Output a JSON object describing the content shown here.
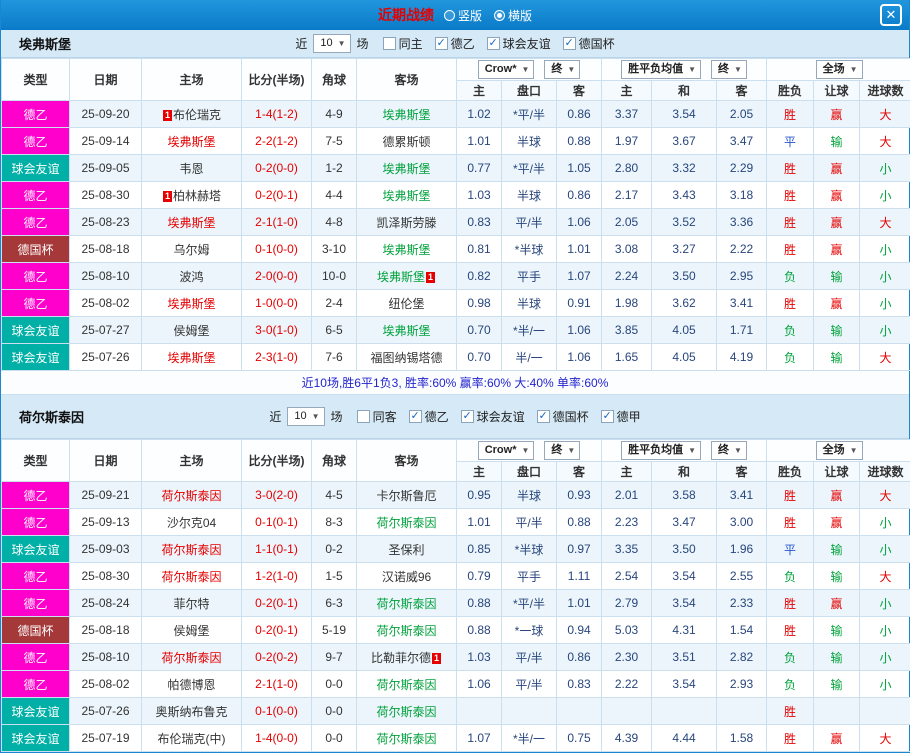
{
  "window": {
    "title": "近期战绩",
    "view_options": [
      {
        "label": "竖版",
        "sel_class": ""
      },
      {
        "label": "横版",
        "sel_class": "sel"
      }
    ],
    "close_label": "✕"
  },
  "ui": {
    "arrow": "▼"
  },
  "thead": {
    "type": "类型",
    "date": "日期",
    "home": "主场",
    "score": "比分(半场)",
    "corners": "角球",
    "away": "客场",
    "company": "Crow*",
    "final": "终",
    "avg": "胜平负均值",
    "full": "全场",
    "sub": [
      "主",
      "盘口",
      "客",
      "主",
      "和",
      "客",
      "胜负",
      "让球",
      "进球数"
    ]
  },
  "sections": [
    {
      "team": "埃弗斯堡",
      "filters": {
        "near_label": "近",
        "count": "10",
        "games_label": "场",
        "checkboxes": [
          {
            "label": "同主",
            "checked": "",
            "check_glyph": ""
          },
          {
            "label": "德乙",
            "checked": "checked",
            "check_glyph": "✓"
          },
          {
            "label": "球会友谊",
            "checked": "checked",
            "check_glyph": "✓"
          },
          {
            "label": "德国杯",
            "checked": "checked",
            "check_glyph": "✓"
          }
        ]
      },
      "rows": [
        {
          "league": "德乙",
          "league_class": "lg-m",
          "date": "25-09-20",
          "home_badge": "1",
          "home": "布伦瑞克",
          "home_class": "",
          "score": "1-4(1-2)",
          "corners": "4-9",
          "away": "埃弗斯堡",
          "away_class": "t-green",
          "away_badge": "",
          "o1": "1.02",
          "o2": "*平/半",
          "o3": "0.86",
          "a1": "3.37",
          "a2": "3.54",
          "a3": "2.05",
          "r1": "胜",
          "r1c": "t-red",
          "r2": "赢",
          "r2c": "t-red",
          "r3": "大",
          "r3c": "t-red"
        },
        {
          "league": "德乙",
          "league_class": "lg-m",
          "date": "25-09-14",
          "home_badge": "",
          "home": "埃弗斯堡",
          "home_class": "t-red",
          "score": "2-2(1-2)",
          "corners": "7-5",
          "away": "德累斯顿",
          "away_class": "",
          "away_badge": "",
          "o1": "1.01",
          "o2": "半球",
          "o3": "0.88",
          "a1": "1.97",
          "a2": "3.67",
          "a3": "3.47",
          "r1": "平",
          "r1c": "t-blue",
          "r2": "输",
          "r2c": "t-green",
          "r3": "大",
          "r3c": "t-red"
        },
        {
          "league": "球会友谊",
          "league_class": "lg-t",
          "date": "25-09-05",
          "home_badge": "",
          "home": "韦恩",
          "home_class": "",
          "score": "0-2(0-0)",
          "corners": "1-2",
          "away": "埃弗斯堡",
          "away_class": "t-green",
          "away_badge": "",
          "o1": "0.77",
          "o2": "*平/半",
          "o3": "1.05",
          "a1": "2.80",
          "a2": "3.32",
          "a3": "2.29",
          "r1": "胜",
          "r1c": "t-red",
          "r2": "赢",
          "r2c": "t-red",
          "r3": "小",
          "r3c": "t-green"
        },
        {
          "league": "德乙",
          "league_class": "lg-m",
          "date": "25-08-30",
          "home_badge": "1",
          "home": "柏林赫塔",
          "home_class": "",
          "score": "0-2(0-1)",
          "corners": "4-4",
          "away": "埃弗斯堡",
          "away_class": "t-green",
          "away_badge": "",
          "o1": "1.03",
          "o2": "半球",
          "o3": "0.86",
          "a1": "2.17",
          "a2": "3.43",
          "a3": "3.18",
          "r1": "胜",
          "r1c": "t-red",
          "r2": "赢",
          "r2c": "t-red",
          "r3": "小",
          "r3c": "t-green"
        },
        {
          "league": "德乙",
          "league_class": "lg-m",
          "date": "25-08-23",
          "home_badge": "",
          "home": "埃弗斯堡",
          "home_class": "t-red",
          "score": "2-1(1-0)",
          "corners": "4-8",
          "away": "凯泽斯劳滕",
          "away_class": "",
          "away_badge": "",
          "o1": "0.83",
          "o2": "平/半",
          "o3": "1.06",
          "a1": "2.05",
          "a2": "3.52",
          "a3": "3.36",
          "r1": "胜",
          "r1c": "t-red",
          "r2": "赢",
          "r2c": "t-red",
          "r3": "大",
          "r3c": "t-red"
        },
        {
          "league": "德国杯",
          "league_class": "lg-d",
          "date": "25-08-18",
          "home_badge": "",
          "home": "乌尔姆",
          "home_class": "",
          "score": "0-1(0-0)",
          "corners": "3-10",
          "away": "埃弗斯堡",
          "away_class": "t-green",
          "away_badge": "",
          "o1": "0.81",
          "o2": "*半球",
          "o3": "1.01",
          "a1": "3.08",
          "a2": "3.27",
          "a3": "2.22",
          "r1": "胜",
          "r1c": "t-red",
          "r2": "赢",
          "r2c": "t-red",
          "r3": "小",
          "r3c": "t-green"
        },
        {
          "league": "德乙",
          "league_class": "lg-m",
          "date": "25-08-10",
          "home_badge": "",
          "home": "波鸿",
          "home_class": "",
          "score": "2-0(0-0)",
          "corners": "10-0",
          "away": "埃弗斯堡",
          "away_class": "t-green",
          "away_badge": "1",
          "o1": "0.82",
          "o2": "平手",
          "o3": "1.07",
          "a1": "2.24",
          "a2": "3.50",
          "a3": "2.95",
          "r1": "负",
          "r1c": "t-green",
          "r2": "输",
          "r2c": "t-green",
          "r3": "小",
          "r3c": "t-green"
        },
        {
          "league": "德乙",
          "league_class": "lg-m",
          "date": "25-08-02",
          "home_badge": "",
          "home": "埃弗斯堡",
          "home_class": "t-red",
          "score": "1-0(0-0)",
          "corners": "2-4",
          "away": "纽伦堡",
          "away_class": "",
          "away_badge": "",
          "o1": "0.98",
          "o2": "半球",
          "o3": "0.91",
          "a1": "1.98",
          "a2": "3.62",
          "a3": "3.41",
          "r1": "胜",
          "r1c": "t-red",
          "r2": "赢",
          "r2c": "t-red",
          "r3": "小",
          "r3c": "t-green"
        },
        {
          "league": "球会友谊",
          "league_class": "lg-t",
          "date": "25-07-27",
          "home_badge": "",
          "home": "侯姆堡",
          "home_class": "",
          "score": "3-0(1-0)",
          "corners": "6-5",
          "away": "埃弗斯堡",
          "away_class": "t-green",
          "away_badge": "",
          "o1": "0.70",
          "o2": "*半/一",
          "o3": "1.06",
          "a1": "3.85",
          "a2": "4.05",
          "a3": "1.71",
          "r1": "负",
          "r1c": "t-green",
          "r2": "输",
          "r2c": "t-green",
          "r3": "小",
          "r3c": "t-green"
        },
        {
          "league": "球会友谊",
          "league_class": "lg-t",
          "date": "25-07-26",
          "home_badge": "",
          "home": "埃弗斯堡",
          "home_class": "t-red",
          "score": "2-3(1-0)",
          "corners": "7-6",
          "away": "福图纳锡塔德",
          "away_class": "",
          "away_badge": "",
          "o1": "0.70",
          "o2": "半/一",
          "o3": "1.06",
          "a1": "1.65",
          "a2": "4.05",
          "a3": "4.19",
          "r1": "负",
          "r1c": "t-green",
          "r2": "输",
          "r2c": "t-green",
          "r3": "大",
          "r3c": "t-red"
        }
      ],
      "summary": "近10场,胜6平1负3, 胜率:60% 赢率:60% 大:40% 单率:60%"
    },
    {
      "team": "荷尔斯泰因",
      "filters": {
        "near_label": "近",
        "count": "10",
        "games_label": "场",
        "checkboxes": [
          {
            "label": "同客",
            "checked": "",
            "check_glyph": ""
          },
          {
            "label": "德乙",
            "checked": "checked",
            "check_glyph": "✓"
          },
          {
            "label": "球会友谊",
            "checked": "checked",
            "check_glyph": "✓"
          },
          {
            "label": "德国杯",
            "checked": "checked",
            "check_glyph": "✓"
          },
          {
            "label": "德甲",
            "checked": "checked",
            "check_glyph": "✓"
          }
        ]
      },
      "rows": [
        {
          "league": "德乙",
          "league_class": "lg-m",
          "date": "25-09-21",
          "home_badge": "",
          "home": "荷尔斯泰因",
          "home_class": "t-red",
          "score": "3-0(2-0)",
          "corners": "4-5",
          "away": "卡尔斯鲁厄",
          "away_class": "",
          "away_badge": "",
          "o1": "0.95",
          "o2": "半球",
          "o3": "0.93",
          "a1": "2.01",
          "a2": "3.58",
          "a3": "3.41",
          "r1": "胜",
          "r1c": "t-red",
          "r2": "赢",
          "r2c": "t-red",
          "r3": "大",
          "r3c": "t-red"
        },
        {
          "league": "德乙",
          "league_class": "lg-m",
          "date": "25-09-13",
          "home_badge": "",
          "home": "沙尔克04",
          "home_class": "",
          "score": "0-1(0-1)",
          "corners": "8-3",
          "away": "荷尔斯泰因",
          "away_class": "t-green",
          "away_badge": "",
          "o1": "1.01",
          "o2": "平/半",
          "o3": "0.88",
          "a1": "2.23",
          "a2": "3.47",
          "a3": "3.00",
          "r1": "胜",
          "r1c": "t-red",
          "r2": "赢",
          "r2c": "t-red",
          "r3": "小",
          "r3c": "t-green"
        },
        {
          "league": "球会友谊",
          "league_class": "lg-t",
          "date": "25-09-03",
          "home_badge": "",
          "home": "荷尔斯泰因",
          "home_class": "t-red",
          "score": "1-1(0-1)",
          "corners": "0-2",
          "away": "圣保利",
          "away_class": "",
          "away_badge": "",
          "o1": "0.85",
          "o2": "*半球",
          "o3": "0.97",
          "a1": "3.35",
          "a2": "3.50",
          "a3": "1.96",
          "r1": "平",
          "r1c": "t-blue",
          "r2": "输",
          "r2c": "t-green",
          "r3": "小",
          "r3c": "t-green"
        },
        {
          "league": "德乙",
          "league_class": "lg-m",
          "date": "25-08-30",
          "home_badge": "",
          "home": "荷尔斯泰因",
          "home_class": "t-red",
          "score": "1-2(1-0)",
          "corners": "1-5",
          "away": "汉诺威96",
          "away_class": "",
          "away_badge": "",
          "o1": "0.79",
          "o2": "平手",
          "o3": "1.11",
          "a1": "2.54",
          "a2": "3.54",
          "a3": "2.55",
          "r1": "负",
          "r1c": "t-green",
          "r2": "输",
          "r2c": "t-green",
          "r3": "大",
          "r3c": "t-red"
        },
        {
          "league": "德乙",
          "league_class": "lg-m",
          "date": "25-08-24",
          "home_badge": "",
          "home": "菲尔特",
          "home_class": "",
          "score": "0-2(0-1)",
          "corners": "6-3",
          "away": "荷尔斯泰因",
          "away_class": "t-green",
          "away_badge": "",
          "o1": "0.88",
          "o2": "*平/半",
          "o3": "1.01",
          "a1": "2.79",
          "a2": "3.54",
          "a3": "2.33",
          "r1": "胜",
          "r1c": "t-red",
          "r2": "赢",
          "r2c": "t-red",
          "r3": "小",
          "r3c": "t-green"
        },
        {
          "league": "德国杯",
          "league_class": "lg-d",
          "date": "25-08-18",
          "home_badge": "",
          "home": "侯姆堡",
          "home_class": "",
          "score": "0-2(0-1)",
          "corners": "5-19",
          "away": "荷尔斯泰因",
          "away_class": "t-green",
          "away_badge": "",
          "o1": "0.88",
          "o2": "*一球",
          "o3": "0.94",
          "a1": "5.03",
          "a2": "4.31",
          "a3": "1.54",
          "r1": "胜",
          "r1c": "t-red",
          "r2": "输",
          "r2c": "t-green",
          "r3": "小",
          "r3c": "t-green"
        },
        {
          "league": "德乙",
          "league_class": "lg-m",
          "date": "25-08-10",
          "home_badge": "",
          "home": "荷尔斯泰因",
          "home_class": "t-red",
          "score": "0-2(0-2)",
          "corners": "9-7",
          "away": "比勒菲尔德",
          "away_class": "",
          "away_badge": "1",
          "o1": "1.03",
          "o2": "平/半",
          "o3": "0.86",
          "a1": "2.30",
          "a2": "3.51",
          "a3": "2.82",
          "r1": "负",
          "r1c": "t-green",
          "r2": "输",
          "r2c": "t-green",
          "r3": "小",
          "r3c": "t-green"
        },
        {
          "league": "德乙",
          "league_class": "lg-m",
          "date": "25-08-02",
          "home_badge": "",
          "home": "帕德博恩",
          "home_class": "",
          "score": "2-1(1-0)",
          "corners": "0-0",
          "away": "荷尔斯泰因",
          "away_class": "t-green",
          "away_badge": "",
          "o1": "1.06",
          "o2": "平/半",
          "o3": "0.83",
          "a1": "2.22",
          "a2": "3.54",
          "a3": "2.93",
          "r1": "负",
          "r1c": "t-green",
          "r2": "输",
          "r2c": "t-green",
          "r3": "小",
          "r3c": "t-green"
        },
        {
          "league": "球会友谊",
          "league_class": "lg-t",
          "date": "25-07-26",
          "home_badge": "",
          "home": "奥斯纳布鲁克",
          "home_class": "",
          "score": "0-1(0-0)",
          "corners": "0-0",
          "away": "荷尔斯泰因",
          "away_class": "t-green",
          "away_badge": "",
          "o1": "",
          "o2": "",
          "o3": "",
          "a1": "",
          "a2": "",
          "a3": "",
          "r1": "胜",
          "r1c": "t-red",
          "r2": "",
          "r2c": "",
          "r3": "",
          "r3c": ""
        },
        {
          "league": "球会友谊",
          "league_class": "lg-t",
          "date": "25-07-19",
          "home_badge": "",
          "home": "布伦瑞克(中)",
          "home_class": "",
          "score": "1-4(0-0)",
          "corners": "0-0",
          "away": "荷尔斯泰因",
          "away_class": "t-green",
          "away_badge": "",
          "o1": "1.07",
          "o2": "*半/一",
          "o3": "0.75",
          "a1": "4.39",
          "a2": "4.44",
          "a3": "1.58",
          "r1": "胜",
          "r1c": "t-red",
          "r2": "赢",
          "r2c": "t-red",
          "r3": "大",
          "r3c": "t-red"
        }
      ]
    }
  ]
}
